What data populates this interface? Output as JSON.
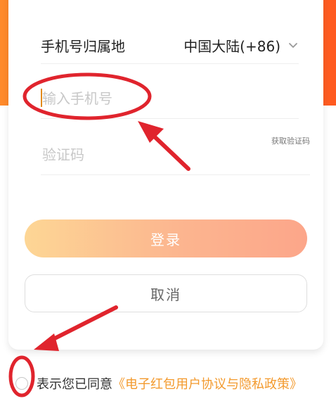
{
  "form": {
    "region_label": "手机号归属地",
    "region_value": "中国大陆(+86)",
    "phone_placeholder": "输入手机号",
    "code_placeholder": "验证码",
    "get_code_label": "获取验证码",
    "login_label": "登录",
    "cancel_label": "取消"
  },
  "agreement": {
    "text": "表示您已同意",
    "link": "《电子红包用户协议与隐私政策》"
  },
  "colors": {
    "header_gradient_start": "#ff8a2a",
    "header_gradient_end": "#ff5a20",
    "login_gradient_start": "#fdd695",
    "login_gradient_end": "#fca68a",
    "link": "#f39a2e",
    "annotation": "#e0242d"
  },
  "icons": {
    "region_dropdown": "chevron-down-icon",
    "annotation_arrows": "arrow-icon",
    "annotation_circles": "ellipse-highlight"
  }
}
